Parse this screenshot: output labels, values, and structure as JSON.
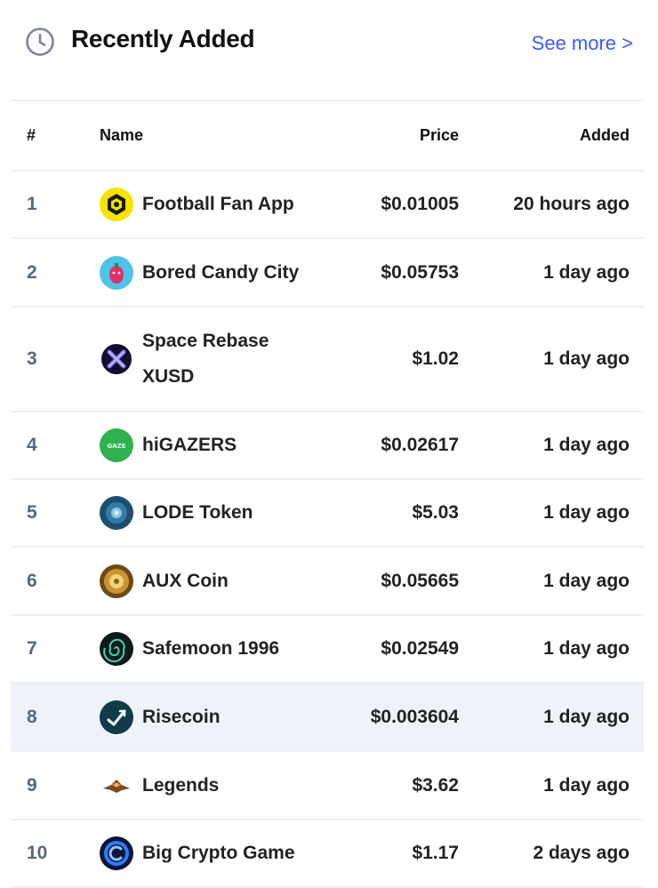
{
  "header": {
    "title": "Recently Added",
    "see_more": "See more >"
  },
  "table": {
    "columns": {
      "rank": "#",
      "name": "Name",
      "price": "Price",
      "added": "Added"
    },
    "rows": [
      {
        "rank": "1",
        "name": "Football Fan App",
        "price": "$0.01005",
        "added": "20 hours ago",
        "logo": "football-fan-app-logo"
      },
      {
        "rank": "2",
        "name": "Bored Candy City",
        "price": "$0.05753",
        "added": "1 day ago",
        "logo": "bored-candy-city-logo"
      },
      {
        "rank": "3",
        "name": "Space Rebase XUSD",
        "price": "$1.02",
        "added": "1 day ago",
        "logo": "space-rebase-xusd-logo"
      },
      {
        "rank": "4",
        "name": "hiGAZERS",
        "price": "$0.02617",
        "added": "1 day ago",
        "logo": "higazers-logo"
      },
      {
        "rank": "5",
        "name": "LODE Token",
        "price": "$5.03",
        "added": "1 day ago",
        "logo": "lode-token-logo"
      },
      {
        "rank": "6",
        "name": "AUX Coin",
        "price": "$0.05665",
        "added": "1 day ago",
        "logo": "aux-coin-logo"
      },
      {
        "rank": "7",
        "name": "Safemoon 1996",
        "price": "$0.02549",
        "added": "1 day ago",
        "logo": "safemoon-1996-logo"
      },
      {
        "rank": "8",
        "name": "Risecoin",
        "price": "$0.003604",
        "added": "1 day ago",
        "logo": "risecoin-logo"
      },
      {
        "rank": "9",
        "name": "Legends",
        "price": "$3.62",
        "added": "1 day ago",
        "logo": "legends-logo"
      },
      {
        "rank": "10",
        "name": "Big Crypto Game",
        "price": "$1.17",
        "added": "2 days ago",
        "logo": "big-crypto-game-logo"
      }
    ]
  },
  "colors": {
    "link": "#3b5bfd",
    "highlight_row": "#eef3fa",
    "rank_text": "#58667e"
  }
}
